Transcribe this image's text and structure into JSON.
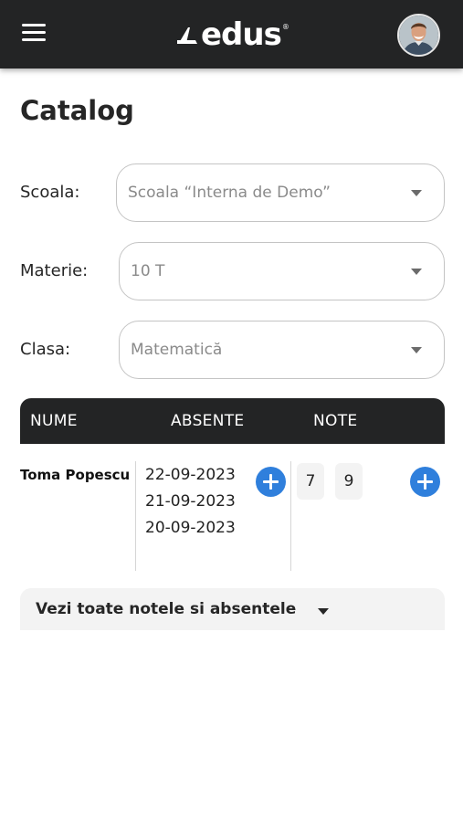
{
  "header": {
    "brand": "edus",
    "brand_mark": "®"
  },
  "page": {
    "title": "Catalog"
  },
  "filters": {
    "school": {
      "label": "Scoala:",
      "value": "Scoala “Interna de Demo”"
    },
    "subject": {
      "label": "Materie:",
      "value": "10 T"
    },
    "class": {
      "label": "Clasa:",
      "value": "Matematică"
    }
  },
  "table": {
    "headers": {
      "name": "NUME",
      "absences": "ABSENTE",
      "grades": "NOTE"
    },
    "rows": [
      {
        "name": "Toma Popescu",
        "absences": [
          "22-09-2023",
          "21-09-2023",
          "20-09-2023"
        ],
        "grades": [
          "7",
          "9"
        ]
      }
    ]
  },
  "footer_toggle": {
    "label": "Vezi toate notele si absentele"
  },
  "colors": {
    "header_bg": "#232425",
    "accent_blue": "#2f7fdc"
  }
}
